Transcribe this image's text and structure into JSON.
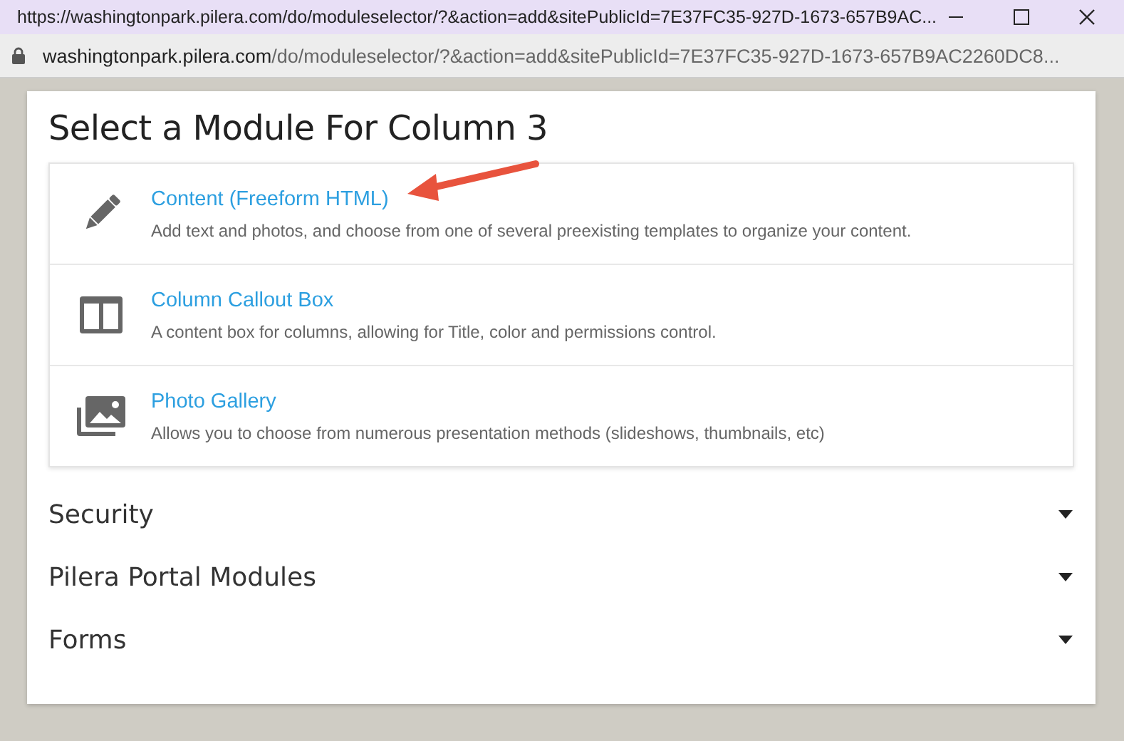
{
  "window": {
    "title": "https://washingtonpark.pilera.com/do/moduleselector/?&action=add&sitePublicId=7E37FC35-927D-1673-657B9AC..."
  },
  "address": {
    "host": "washingtonpark.pilera.com",
    "path": "/do/moduleselector/?&action=add&sitePublicId=7E37FC35-927D-1673-657B9AC2260DC8..."
  },
  "heading": "Select a Module For Column 3",
  "modules": [
    {
      "kind": "pencil",
      "name": "Content (Freeform HTML)",
      "description": "Add text and photos, and choose from one of several preexisting templates to organize your content.",
      "annotated": true
    },
    {
      "kind": "columns",
      "name": "Column Callout Box",
      "description": "A content box for columns, allowing for Title, color and permissions control.",
      "annotated": false
    },
    {
      "kind": "photos",
      "name": "Photo Gallery",
      "description": "Allows you to choose from numerous presentation methods (slideshows, thumbnails, etc)",
      "annotated": false
    }
  ],
  "sections": [
    {
      "label": "Security",
      "expanded": false
    },
    {
      "label": "Pilera Portal Modules",
      "expanded": false
    },
    {
      "label": "Forms",
      "expanded": false
    }
  ]
}
